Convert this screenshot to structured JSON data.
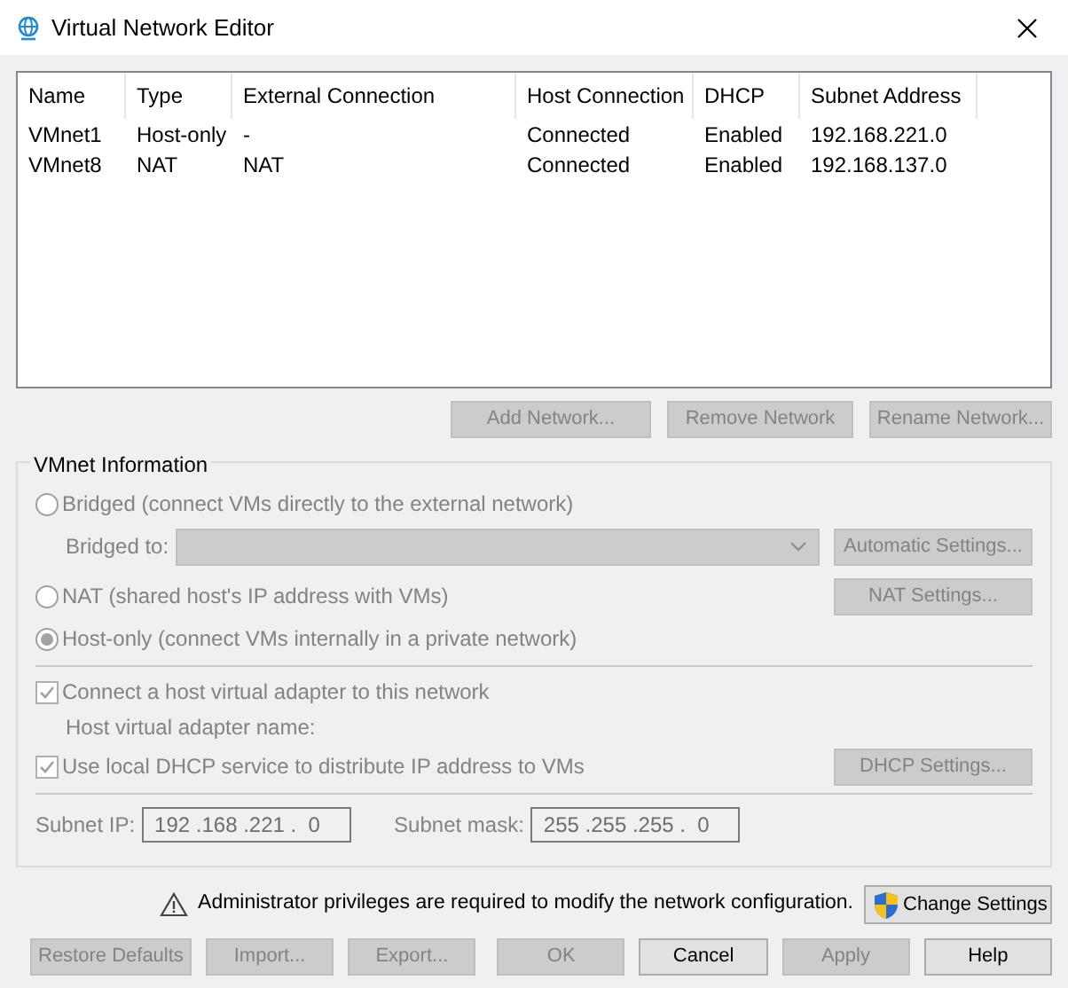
{
  "window": {
    "title": "Virtual Network Editor"
  },
  "table": {
    "columns": [
      "Name",
      "Type",
      "External Connection",
      "Host Connection",
      "DHCP",
      "Subnet Address"
    ],
    "rows": [
      {
        "cells": [
          "VMnet1",
          "Host-only",
          "-",
          "Connected",
          "Enabled",
          "192.168.221.0"
        ]
      },
      {
        "cells": [
          "VMnet8",
          "NAT",
          "NAT",
          "Connected",
          "Enabled",
          "192.168.137.0"
        ]
      }
    ]
  },
  "network_buttons": [
    {
      "label": "Add Network...",
      "disabled": true
    },
    {
      "label": "Remove Network",
      "disabled": true
    },
    {
      "label": "Rename Network...",
      "disabled": true
    }
  ],
  "vmnet_info": {
    "title": "VMnet Information",
    "bridged": {
      "label": "Bridged (connect VMs directly to the external network)",
      "selected": false,
      "disabled": true
    },
    "bridged_to": {
      "label": "Bridged to:",
      "disabled": true
    },
    "automatic_settings": {
      "label": "Automatic Settings...",
      "disabled": true
    },
    "nat": {
      "label": "NAT (shared host's IP address with VMs)",
      "selected": false,
      "disabled": true
    },
    "nat_settings": {
      "label": "NAT Settings...",
      "disabled": true
    },
    "host_only": {
      "label": "Host-only (connect VMs internally in a private network)",
      "selected": true,
      "disabled": true
    },
    "connect_adapter": {
      "label": "Connect a host virtual adapter to this network",
      "checked": true,
      "disabled": true
    },
    "adapter_name_label": "Host virtual adapter name:",
    "use_dhcp": {
      "label": "Use local DHCP service to distribute IP address to VMs",
      "checked": true,
      "disabled": true
    },
    "dhcp_settings": {
      "label": "DHCP Settings...",
      "disabled": true
    },
    "subnet_ip": {
      "label": "Subnet IP:",
      "value": "192 .168 .221 .  0"
    },
    "subnet_mask": {
      "label": "Subnet mask:",
      "value": "255 .255 .255 .  0"
    }
  },
  "notice": {
    "text": "Administrator privileges are required to modify the network configuration.",
    "button": "Change Settings"
  },
  "buttons": [
    {
      "label": "Restore Defaults",
      "disabled": true
    },
    {
      "label": "Import...",
      "disabled": true
    },
    {
      "label": "Export...",
      "disabled": true
    },
    {
      "label": "OK",
      "disabled": true
    },
    {
      "label": "Cancel",
      "disabled": false
    },
    {
      "label": "Apply",
      "disabled": true
    },
    {
      "label": "Help",
      "disabled": false
    }
  ]
}
